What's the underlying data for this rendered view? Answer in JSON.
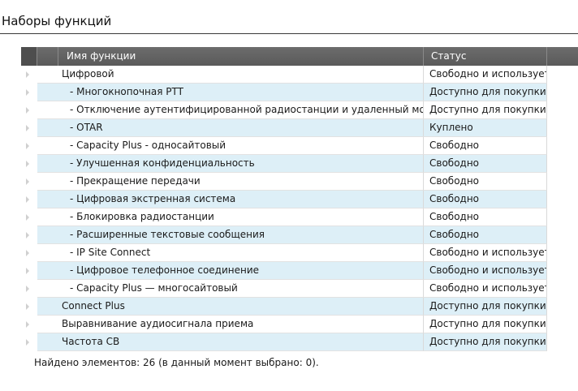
{
  "page": {
    "title": "Наборы функций"
  },
  "grid": {
    "columns": {
      "name": "Имя функции",
      "status": "Статус"
    },
    "rows": [
      {
        "name": "Цифровой",
        "status": "Свободно и используется",
        "level": 0
      },
      {
        "name": "- Многокнопочная PTT",
        "status": "Доступно для покупки",
        "level": 1
      },
      {
        "name": "- Отключение аутентифицированной радиостанции и удаленный мониторинг",
        "status": "Доступно для покупки",
        "level": 1
      },
      {
        "name": "- OTAR",
        "status": "Куплено",
        "level": 1
      },
      {
        "name": "- Capacity Plus - односайтовый",
        "status": "Свободно",
        "level": 1
      },
      {
        "name": "- Улучшенная конфиденциальность",
        "status": "Свободно",
        "level": 1
      },
      {
        "name": "- Прекращение передачи",
        "status": "Свободно",
        "level": 1
      },
      {
        "name": "- Цифровая экстренная система",
        "status": "Свободно",
        "level": 1
      },
      {
        "name": "- Блокировка радиостанции",
        "status": "Свободно",
        "level": 1
      },
      {
        "name": "- Расширенные текстовые сообщения",
        "status": "Свободно",
        "level": 1
      },
      {
        "name": "- IP Site Connect",
        "status": "Свободно и используется",
        "level": 1
      },
      {
        "name": "- Цифровое телефонное соединение",
        "status": "Свободно и используется",
        "level": 1
      },
      {
        "name": "- Capacity Plus — многосайтовый",
        "status": "Свободно и используется",
        "level": 1
      },
      {
        "name": "Connect Plus",
        "status": "Доступно для покупки",
        "level": 0
      },
      {
        "name": "Выравнивание аудиосигнала приема",
        "status": "Доступно для покупки",
        "level": 0
      },
      {
        "name": "Частота СВ",
        "status": "Доступно для покупки",
        "level": 0
      }
    ]
  },
  "status_bar": {
    "text": "Найдено элементов: 26 (в данный момент выбрано: 0)."
  },
  "colors": {
    "header_bg": "#606060",
    "alt_row_bg": "#ddeff7",
    "title_rule": "#3a3a3a"
  }
}
